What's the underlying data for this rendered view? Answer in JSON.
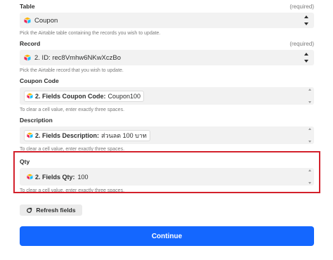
{
  "table": {
    "label": "Table",
    "required": "(required)",
    "value": "Coupon",
    "help": "Pick the Airtable table containing the records you wish to update."
  },
  "record": {
    "label": "Record",
    "required": "(required)",
    "value": "2. ID: rec8Vmhw6NKwXczBo",
    "help": "Pick the Airtable record that you wish to update."
  },
  "coupon_code": {
    "label": "Coupon Code",
    "pill_label": "2. Fields Coupon Code:",
    "pill_value": "Coupon100",
    "help": "To clear a cell value, enter exactly three spaces."
  },
  "description": {
    "label": "Description",
    "pill_label": "2. Fields Description:",
    "pill_value": "ส่วนลด 100 บาท",
    "help": "To clear a cell value, enter exactly three spaces."
  },
  "qty": {
    "label": "Qty",
    "pill_label": "2. Fields Qty:",
    "pill_value": "100",
    "help": "To clear a cell value, enter exactly three spaces."
  },
  "buttons": {
    "refresh": "Refresh fields",
    "continue": "Continue"
  },
  "colors": {
    "primary": "#1467ff",
    "highlight": "#d3202b"
  },
  "icons": {
    "airtable": "airtable-icon",
    "refresh": "refresh-icon"
  }
}
